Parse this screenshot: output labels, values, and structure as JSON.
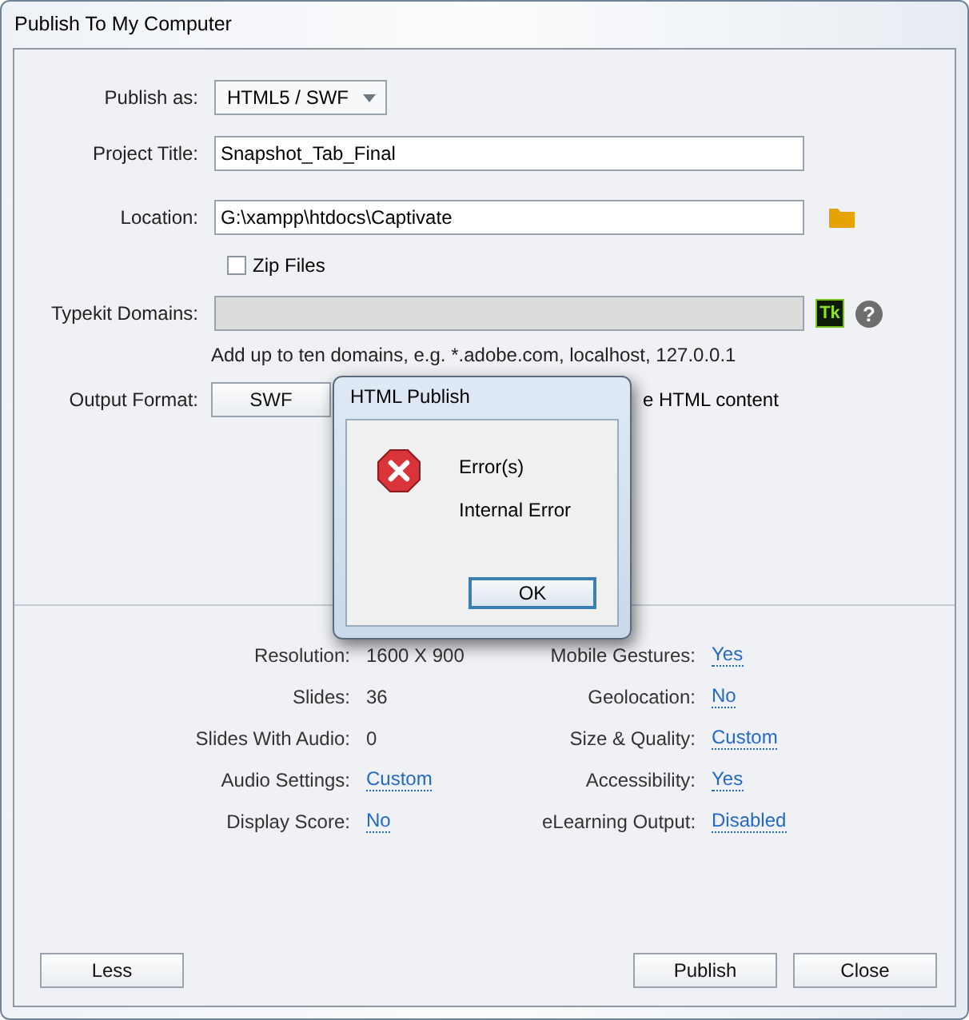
{
  "window": {
    "title": "Publish To My Computer"
  },
  "form": {
    "publish_as": {
      "label": "Publish as:",
      "value": "HTML5 / SWF"
    },
    "project_title": {
      "label": "Project Title:",
      "value": "Snapshot_Tab_Final"
    },
    "location": {
      "label": "Location:",
      "value": "G:\\xampp\\htdocs\\Captivate"
    },
    "zip_files": {
      "label": "Zip Files",
      "checked": false
    },
    "typekit_domains": {
      "label": "Typekit Domains:",
      "disabled": true,
      "badge": "Tk",
      "help": "?",
      "hint": "Add up to ten domains, e.g. *.adobe.com, localhost, 127.0.0.1"
    },
    "output_format": {
      "label": "Output Format:",
      "buttons": [
        "SWF"
      ],
      "include_html": {
        "label": "e HTML content"
      }
    }
  },
  "summary": {
    "left": [
      {
        "label": "Resolution:",
        "value": "1600 X 900",
        "kind": "text"
      },
      {
        "label": "Slides:",
        "value": "36",
        "kind": "text"
      },
      {
        "label": "Slides With Audio:",
        "value": "0",
        "kind": "text"
      },
      {
        "label": "Audio Settings:",
        "value": "Custom",
        "kind": "link"
      },
      {
        "label": "Display Score:",
        "value": "No",
        "kind": "link"
      }
    ],
    "right": [
      {
        "label": "Mobile Gestures:",
        "value": "Yes",
        "kind": "link"
      },
      {
        "label": "Geolocation:",
        "value": "No",
        "kind": "link"
      },
      {
        "label": "Size & Quality:",
        "value": "Custom",
        "kind": "link"
      },
      {
        "label": "Accessibility:",
        "value": "Yes",
        "kind": "link"
      },
      {
        "label": "eLearning Output:",
        "value": "Disabled",
        "kind": "link"
      }
    ]
  },
  "buttons": {
    "left": [
      "Less"
    ],
    "right": [
      "Publish",
      "Close"
    ]
  },
  "error_dialog": {
    "title": "HTML Publish",
    "heading": "Error(s)",
    "message": "Internal Error",
    "button": "OK"
  }
}
